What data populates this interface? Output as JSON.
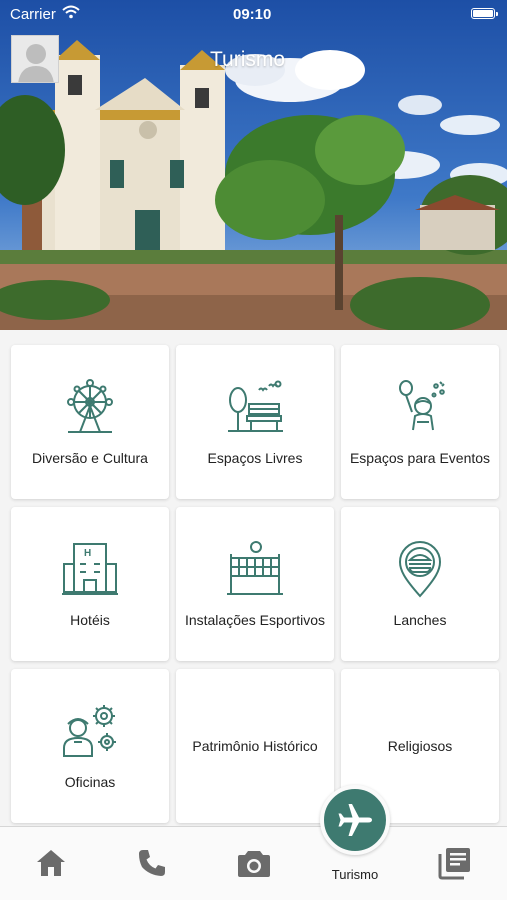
{
  "status_bar": {
    "carrier": "Carrier",
    "time": "09:10"
  },
  "header": {
    "title": "Turismo"
  },
  "categories": [
    {
      "label": "Diversão e Cultura",
      "icon": "ferris-wheel-icon"
    },
    {
      "label": "Espaços Livres",
      "icon": "park-bench-icon"
    },
    {
      "label": "Espaços para Eventos",
      "icon": "balloon-person-icon"
    },
    {
      "label": "Hotéis",
      "icon": "hotel-building-icon"
    },
    {
      "label": "Instalações Esportivos",
      "icon": "volleyball-net-icon"
    },
    {
      "label": "Lanches",
      "icon": "burger-location-icon"
    },
    {
      "label": "Oficinas",
      "icon": "worker-gears-icon"
    },
    {
      "label": "Patrimônio Histórico",
      "icon": ""
    },
    {
      "label": "Religiosos",
      "icon": ""
    }
  ],
  "tabbar": {
    "items": [
      {
        "icon": "home-icon"
      },
      {
        "icon": "phone-icon"
      },
      {
        "icon": "camera-icon"
      },
      {
        "icon": "airplane-icon",
        "label": "Turismo",
        "active": true
      },
      {
        "icon": "news-icon"
      }
    ]
  },
  "colors": {
    "accent": "#3e7a70",
    "icon_stroke": "#3e7a70",
    "tab_inactive": "#6b6b6b"
  }
}
